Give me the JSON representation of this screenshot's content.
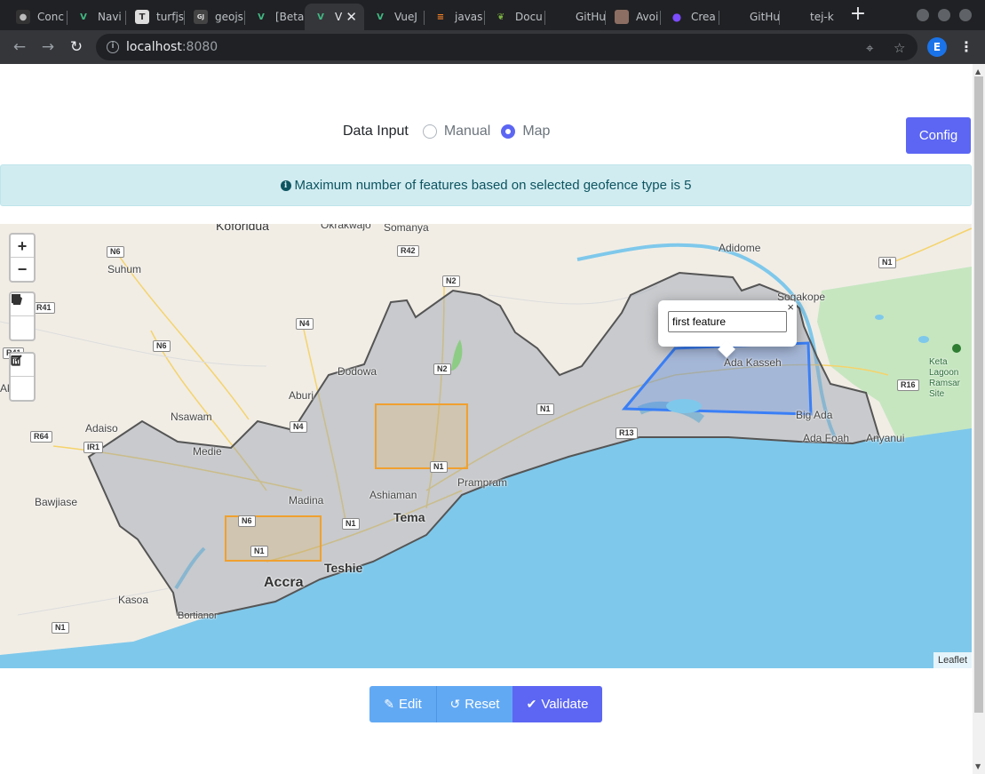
{
  "browser": {
    "tabs": [
      {
        "label": "Conc",
        "icon": "github-icon"
      },
      {
        "label": "Navi",
        "icon": "vue-icon"
      },
      {
        "label": "turfjs",
        "icon": "turf-icon"
      },
      {
        "label": "geojs",
        "icon": "geojson-icon"
      },
      {
        "label": "[Beta",
        "icon": "vue-icon"
      },
      {
        "label": "V",
        "icon": "vue-icon",
        "active": true
      },
      {
        "label": "VueJ",
        "icon": "vue-icon"
      },
      {
        "label": "javas",
        "icon": "stackoverflow-icon"
      },
      {
        "label": "Docu",
        "icon": "leaf-icon"
      },
      {
        "label": "GitHu",
        "icon": "github-icon"
      },
      {
        "label": "Avoi",
        "icon": "avatar-icon"
      },
      {
        "label": "Crea",
        "icon": "circles-icon"
      },
      {
        "label": "GitHu",
        "icon": "github-icon"
      },
      {
        "label": "tej-k",
        "icon": "github-icon"
      }
    ],
    "close_tab_glyph": "✕",
    "new_tab_glyph": "+",
    "url_host": "localhost",
    "url_port": ":8080",
    "profile_initial": "E"
  },
  "controls": {
    "data_input_label": "Data Input",
    "options": [
      "Manual",
      "Map"
    ],
    "selected": "Map",
    "config_label": "Config"
  },
  "alert": {
    "text": "Maximum number of features based on selected geofence type is 5"
  },
  "map": {
    "zoom_in": "+",
    "zoom_out": "−",
    "attribution": "Leaflet",
    "popup": {
      "close_glyph": "×",
      "input_value": "first feature"
    },
    "places": [
      "Koforidua",
      "Okrakwajo",
      "Somanya",
      "Adidome",
      "Sogakope",
      "Suhum",
      "Dodowa",
      "Aburi",
      "Nsawam",
      "Adaiso",
      "Medie",
      "Ada Kasseh",
      "Big Ada",
      "Ada Foah",
      "Anyanui",
      "Keta Lagoon Ramsar Site",
      "Bawjiase",
      "Madina",
      "Ashiaman",
      "Prampram",
      "Tema",
      "Teshie",
      "Accra",
      "Kasoa",
      "Bortianor",
      "Ake"
    ],
    "road_shields": [
      "N6",
      "R42",
      "N2",
      "R41",
      "N4",
      "N6",
      "R41",
      "N2",
      "N1",
      "R13",
      "R16",
      "N1",
      "N4",
      "R64",
      "IR1",
      "N1",
      "N6",
      "N1",
      "N1",
      "N1"
    ]
  },
  "actions": {
    "edit_label": "Edit",
    "reset_label": "Reset",
    "validate_label": "Validate"
  },
  "colors": {
    "primary": "#5c66f3",
    "info_button": "#62a9f4",
    "alert_bg": "#d1ecf1",
    "alert_text": "#0c5460",
    "water": "#7ec8eb",
    "polygon_outline": "#555555",
    "drawn_polygon": "#3a7ff6",
    "rectangle": "#f0a030"
  }
}
